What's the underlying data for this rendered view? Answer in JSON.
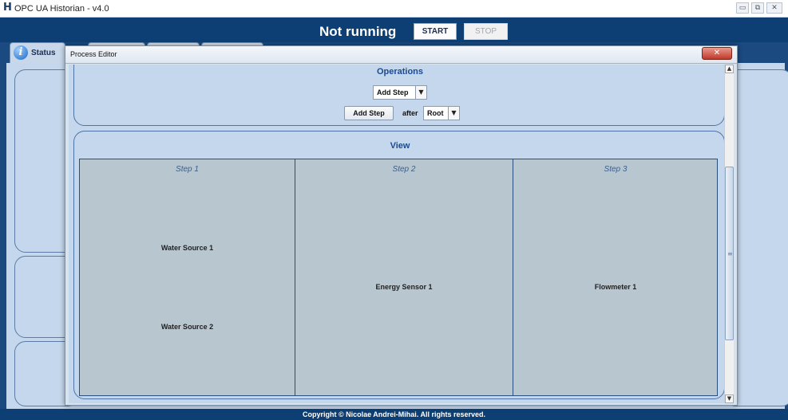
{
  "window": {
    "logo": "H",
    "title": "OPC UA Historian - v4.0",
    "controls": [
      "▭",
      "⧉",
      "✕"
    ]
  },
  "header": {
    "status": "Not running",
    "start_label": "START",
    "stop_label": "STOP"
  },
  "tabs": {
    "status_label": "Status",
    "info_icon": "i"
  },
  "footer": {
    "copyright": "Copyright © Nicolae Andrei-Mihai. All rights reserved."
  },
  "dialog": {
    "title": "Process Editor",
    "close_glyph": "✕",
    "operations": {
      "title": "Operations",
      "operation_combo": "Add Step",
      "add_step_button": "Add Step",
      "after_label": "after",
      "after_combo": "Root"
    },
    "view": {
      "title": "View",
      "steps": [
        {
          "title": "Step 1",
          "items": [
            "Water Source 1",
            "Water Source 2"
          ]
        },
        {
          "title": "Step 2",
          "items": [
            "Energy Sensor 1"
          ]
        },
        {
          "title": "Step 3",
          "items": [
            "Flowmeter 1"
          ]
        }
      ]
    },
    "scrollbar": {
      "up": "▲",
      "down": "▼",
      "grip": "≡"
    }
  },
  "colors": {
    "header_bg": "#0d3f74",
    "panel_bg": "#c5d7ec",
    "step_bg": "#b8c6d0",
    "title_text": "#1a4b8f"
  }
}
